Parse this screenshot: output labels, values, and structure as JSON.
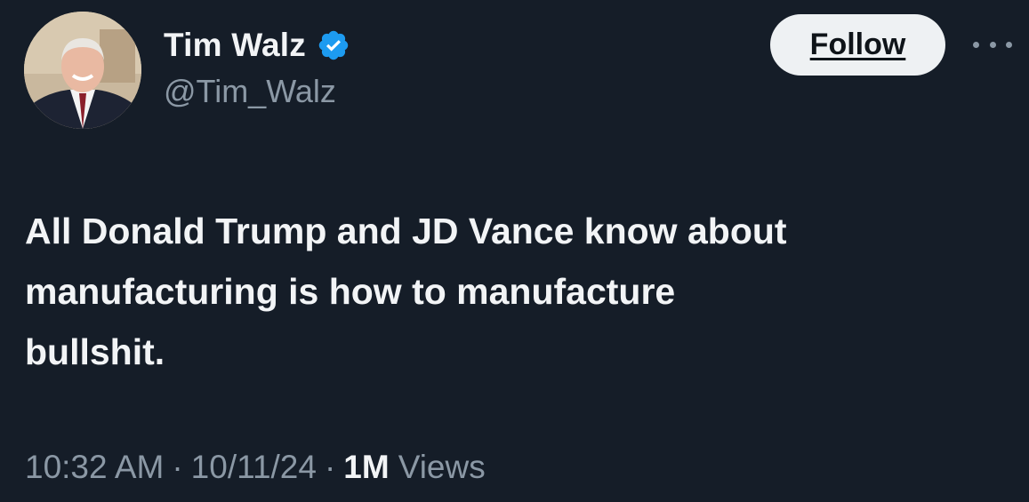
{
  "author": {
    "display_name": "Tim Walz",
    "handle": "@Tim_Walz",
    "verified": true,
    "verified_icon": "verified-badge-icon",
    "verified_color": "#1d9bf0"
  },
  "actions": {
    "follow_label": "Follow",
    "more_icon": "more-horizontal-icon"
  },
  "tweet": {
    "text": "All Donald Trump and JD Vance know about\nmanufacturing is how to manufacture\nbullshit."
  },
  "meta": {
    "time": "10:32 AM",
    "separator": "·",
    "date": "10/11/24",
    "views_count": "1M",
    "views_label": "Views"
  },
  "colors": {
    "background": "#151d28",
    "primary_text": "#f2f4f6",
    "secondary_text": "#8b98a5",
    "follow_bg": "#eef1f3"
  }
}
